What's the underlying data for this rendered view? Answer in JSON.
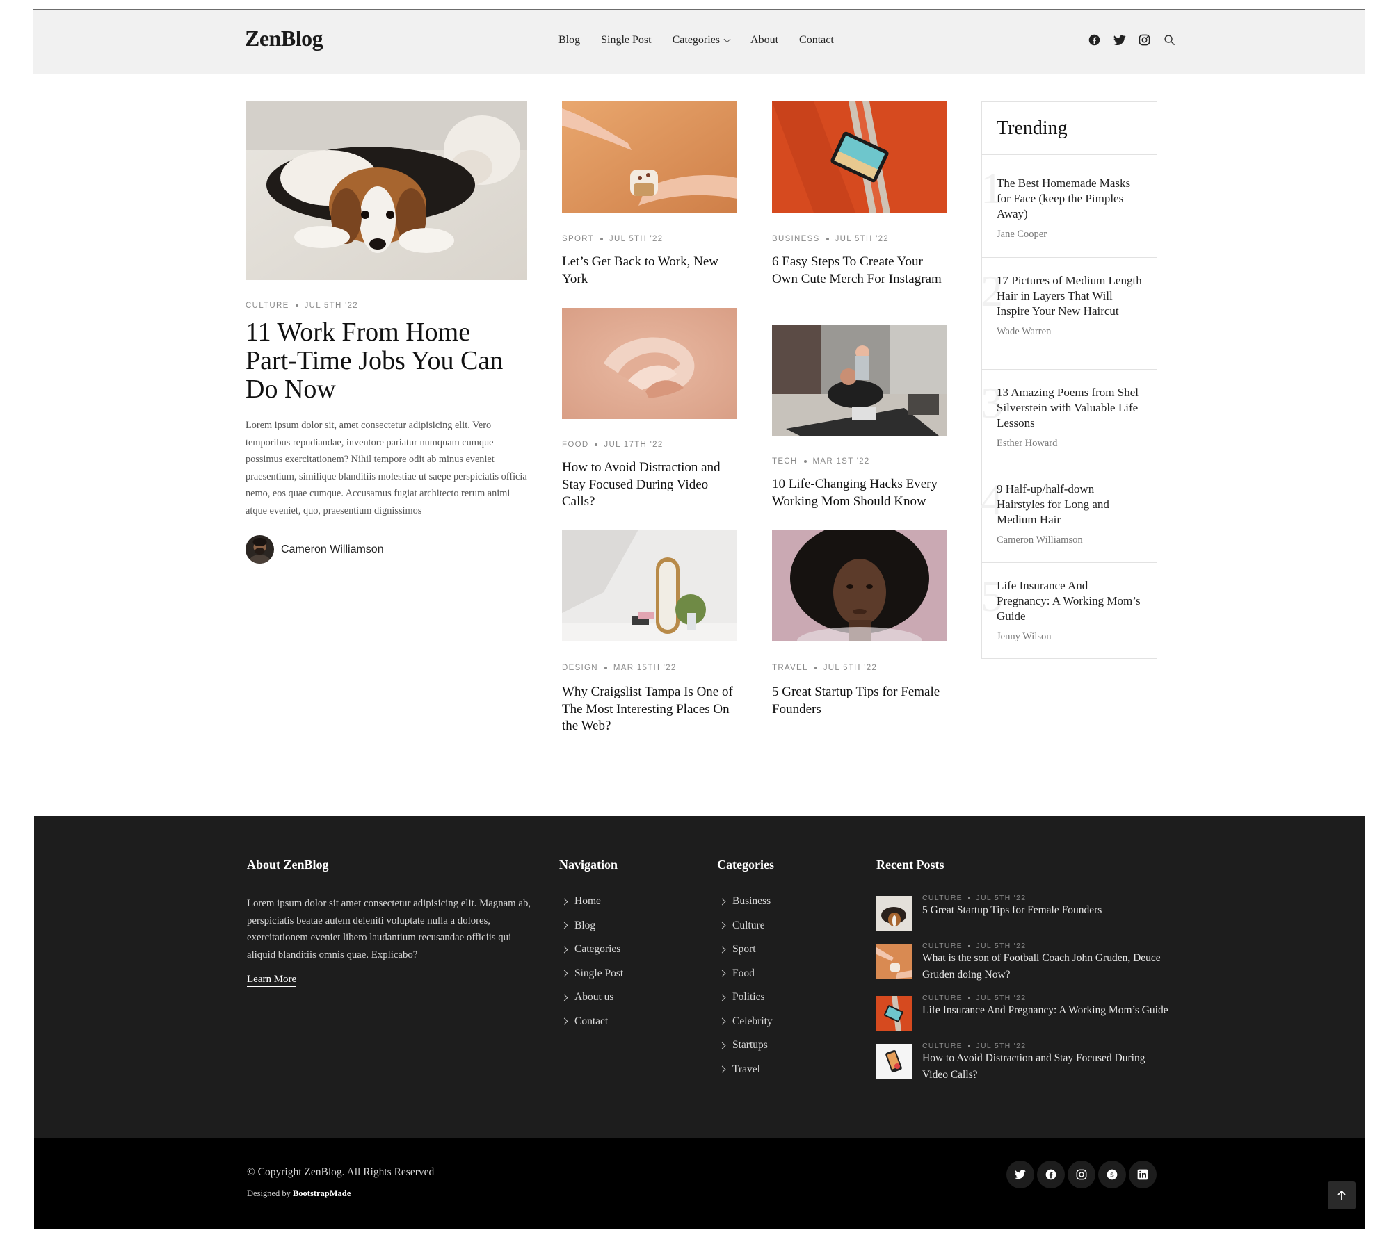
{
  "header": {
    "logo": "ZenBlog",
    "nav": [
      {
        "label": "Blog"
      },
      {
        "label": "Single Post"
      },
      {
        "label": "Categories"
      },
      {
        "label": "About"
      },
      {
        "label": "Contact"
      }
    ],
    "social_icons": [
      "facebook-icon",
      "twitter-icon",
      "instagram-icon",
      "search-icon"
    ]
  },
  "hero": {
    "category": "Culture",
    "date": "Jul 5th '22",
    "title": "11 Work From Home Part-Time Jobs You Can Do Now",
    "excerpt": "Lorem ipsum dolor sit, amet consectetur adipisicing elit. Vero temporibus repudiandae, inventore pariatur numquam cumque possimus exercitationem? Nihil tempore odit ab minus eveniet praesentium, similique blanditiis molestiae ut saepe perspiciatis officia nemo, eos quae cumque. Accusamus fugiat architecto rerum animi atque eveniet, quo, praesentium dignissimos",
    "author": "Cameron Williamson"
  },
  "col1": [
    {
      "category": "Sport",
      "date": "Jul 5th '22",
      "title": "Let’s Get Back to Work, New York"
    },
    {
      "category": "Food",
      "date": "Jul 17th '22",
      "title": "How to Avoid Distraction and Stay Focused During Video Calls?"
    },
    {
      "category": "Design",
      "date": "Mar 15th '22",
      "title": "Why Craigslist Tampa Is One of The Most Interesting Places On the Web?"
    }
  ],
  "col2": [
    {
      "category": "Business",
      "date": "Jul 5th '22",
      "title": "6 Easy Steps To Create Your Own Cute Merch For Instagram"
    },
    {
      "category": "Tech",
      "date": "Mar 1st '22",
      "title": "10 Life-Changing Hacks Every Working Mom Should Know"
    },
    {
      "category": "Travel",
      "date": "Jul 5th '22",
      "title": "5 Great Startup Tips for Female Founders"
    }
  ],
  "trending": {
    "heading": "Trending",
    "items": [
      {
        "num": "1",
        "title": "The Best Homemade Masks for Face (keep the Pimples Away)",
        "author": "Jane Cooper"
      },
      {
        "num": "2",
        "title": "17 Pictures of Medium Length Hair in Layers That Will Inspire Your New Haircut",
        "author": "Wade Warren"
      },
      {
        "num": "3",
        "title": "13 Amazing Poems from Shel Silverstein with Valuable Life Lessons",
        "author": "Esther Howard"
      },
      {
        "num": "4",
        "title": "9 Half-up/half-down Hairstyles for Long and Medium Hair",
        "author": "Cameron Williamson"
      },
      {
        "num": "5",
        "title": "Life Insurance And Pregnancy: A Working Mom’s Guide",
        "author": "Jenny Wilson"
      }
    ]
  },
  "footer": {
    "about_heading": "About ZenBlog",
    "about_text": "Lorem ipsum dolor sit amet consectetur adipisicing elit. Magnam ab, perspiciatis beatae autem deleniti voluptate nulla a dolores, exercitationem eveniet libero laudantium recusandae officiis qui aliquid blanditiis omnis quae. Explicabo?",
    "learn_more": "Learn More",
    "nav_heading": "Navigation",
    "nav_items": [
      "Home",
      "Blog",
      "Categories",
      "Single Post",
      "About us",
      "Contact"
    ],
    "cat_heading": "Categories",
    "cat_items": [
      "Business",
      "Culture",
      "Sport",
      "Food",
      "Politics",
      "Celebrity",
      "Startups",
      "Travel"
    ],
    "recent_heading": "Recent Posts",
    "recent": [
      {
        "category": "Culture",
        "date": "Jul 5th '22",
        "title": "5 Great Startup Tips for Female Founders"
      },
      {
        "category": "Culture",
        "date": "Jul 5th '22",
        "title": "What is the son of Football Coach John Gruden, Deuce Gruden doing Now?"
      },
      {
        "category": "Culture",
        "date": "Jul 5th '22",
        "title": "Life Insurance And Pregnancy: A Working Mom’s Guide"
      },
      {
        "category": "Culture",
        "date": "Jul 5th '22",
        "title": "How to Avoid Distraction and Stay Focused During Video Calls?"
      }
    ],
    "copyright": "© Copyright ZenBlog. All Rights Reserved",
    "designed_by": "Designed by",
    "designer": "BootstrapMade",
    "social_icons": [
      "twitter-icon",
      "facebook-icon",
      "instagram-icon",
      "skype-icon",
      "linkedin-icon"
    ]
  }
}
